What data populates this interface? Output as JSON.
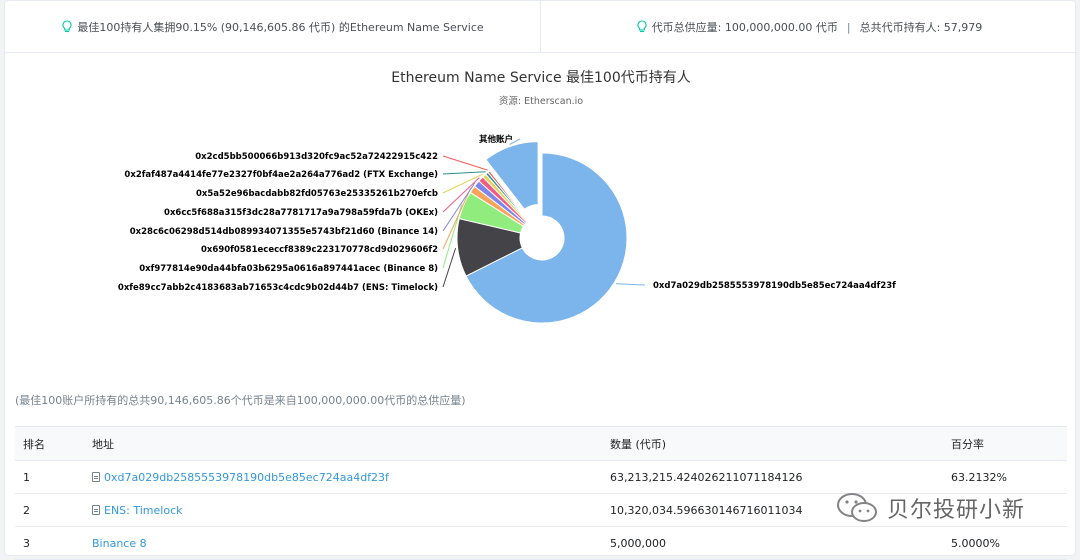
{
  "summary": {
    "top100": "最佳100持有人集拥90.15% (90,146,605.86 代币) 的Ethereum Name Service",
    "supply": "代币总供应量: 100,000,000.00 代币",
    "separator": "|",
    "holders": "总共代币持有人: 57,979"
  },
  "chart_data": {
    "type": "pie",
    "title": "Ethereum Name Service 最佳100代币持有人",
    "subtitle": "资源: Etherscan.io",
    "slices": [
      {
        "label": "0xd7a029db2585553978190db5e85ec724aa4df23f",
        "value": 63.2132,
        "color": "#7cb5ec"
      },
      {
        "label": "0xfe89cc7abb2c4183683ab71653c4cdc9b02d44b7 (ENS: Timelock)",
        "value": 10.32,
        "color": "#434348"
      },
      {
        "label": "0xf977814e90da44bfa03b6295a0616a897441acec (Binance 8)",
        "value": 5.0,
        "color": "#90ed7d"
      },
      {
        "label": "0x690f0581ececcf8389c223170778cd9d029606f2",
        "value": 1.3,
        "color": "#f7a35c"
      },
      {
        "label": "0x28c6c06298d514db089934071355e5743bf21d60 (Binance 14)",
        "value": 1.2,
        "color": "#8085e9"
      },
      {
        "label": "0x6cc5f688a315f3dc28a7781717a9a798a59fda7b (OKEx)",
        "value": 1.0,
        "color": "#f15c80"
      },
      {
        "label": "0x5a52e96bacdabb82fd05763e25335261b270efcb",
        "value": 0.7,
        "color": "#e4d354"
      },
      {
        "label": "0x2faf487a4414fe77e2327f0bf4ae2a264a776ad2 (FTX Exchange)",
        "value": 0.5,
        "color": "#2b908f"
      },
      {
        "label": "0x2cd5bb500066b913d320fc9ac52a72422915c422",
        "value": 0.4,
        "color": "#f45b5b"
      },
      {
        "label": "其他账户",
        "value": 9.85,
        "color": "#7cb5ec"
      }
    ]
  },
  "note": "(最佳100账户所持有的总共90,146,605.86个代币是来自100,000,000.00代币的总供应量)",
  "table": {
    "headers": [
      "排名",
      "地址",
      "数量 (代币)",
      "百分率"
    ],
    "rows": [
      {
        "rank": "1",
        "address": "0xd7a029db2585553978190db5e85ec724aa4df23f",
        "quantity": "63,213,215.424026211071184126",
        "percent": "63.2132%"
      },
      {
        "rank": "2",
        "address": "ENS: Timelock",
        "quantity": "10,320,034.596630146716011034",
        "percent": ""
      },
      {
        "rank": "3",
        "address": "Binance 8",
        "quantity": "5,000,000",
        "percent": "5.0000%"
      }
    ]
  },
  "watermark": "贝尔投研小新"
}
